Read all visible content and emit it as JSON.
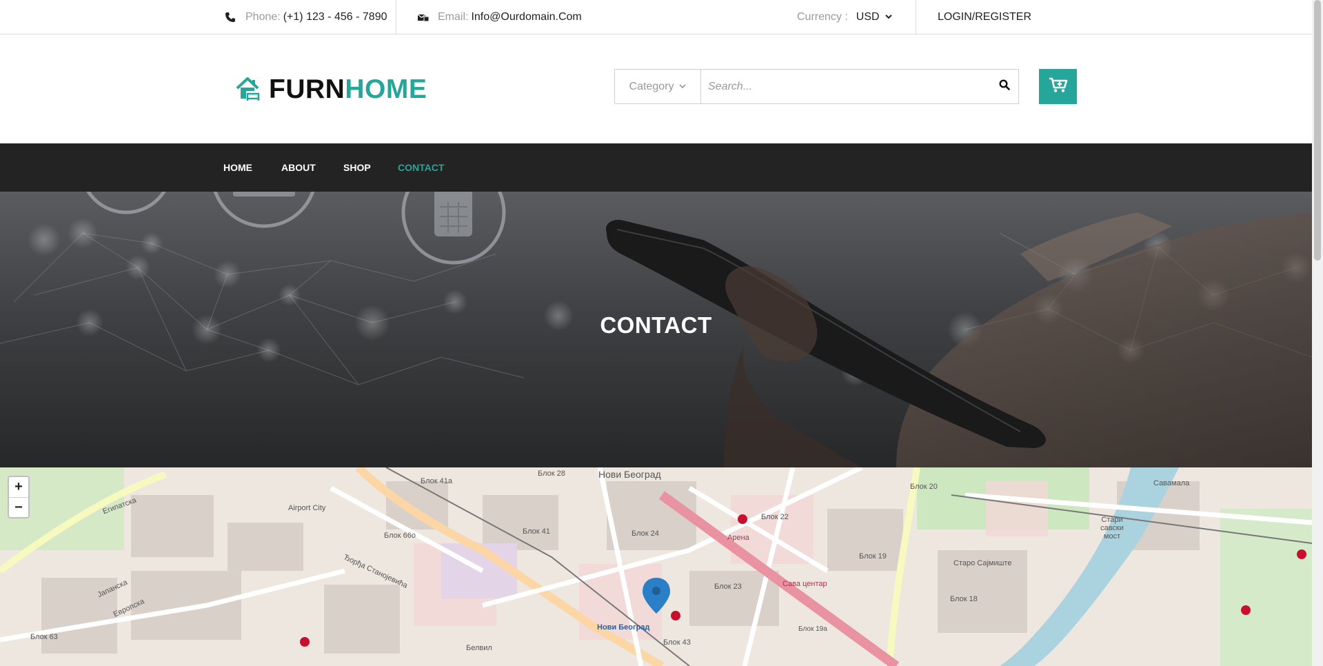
{
  "topbar": {
    "phone_label": "Phone:",
    "phone_value": "(+1) 123 - 456 - 7890",
    "email_label": "Email:",
    "email_value": "Info@Ourdomain.Com",
    "currency_label": "Currency :",
    "currency_value": "USD",
    "login_label": "LOGIN/REGISTER"
  },
  "header": {
    "logo_part1": "FURN",
    "logo_part2": "HOME",
    "category_label": "Category",
    "search_placeholder": "Search..."
  },
  "nav": {
    "items": [
      {
        "label": "HOME"
      },
      {
        "label": "ABOUT"
      },
      {
        "label": "SHOP"
      },
      {
        "label": "CONTACT"
      }
    ]
  },
  "hero": {
    "title": "CONTACT"
  },
  "map": {
    "zoom_in": "+",
    "zoom_out": "−",
    "labels": [
      "Блок 28",
      "Нови Београд",
      "Блок 22",
      "Блок 20",
      "Airport City",
      "Блок 41а",
      "Блок 41",
      "Блок 66о",
      "Блок 24",
      "Блок 19",
      "Блок 23",
      "Сава центар",
      "Нови Београд",
      "Блок 43",
      "Блок 18",
      "Старо Сајмиште",
      "Стари савски мост",
      "Савамала",
      "Блок 63",
      "Блок 19а",
      "Арена",
      "Белвил",
      "Египатска",
      "Јапанска",
      "Европска",
      "Ђорђа Станојевића"
    ]
  },
  "colors": {
    "accent": "#26a69a",
    "nav_bg": "#232323"
  }
}
